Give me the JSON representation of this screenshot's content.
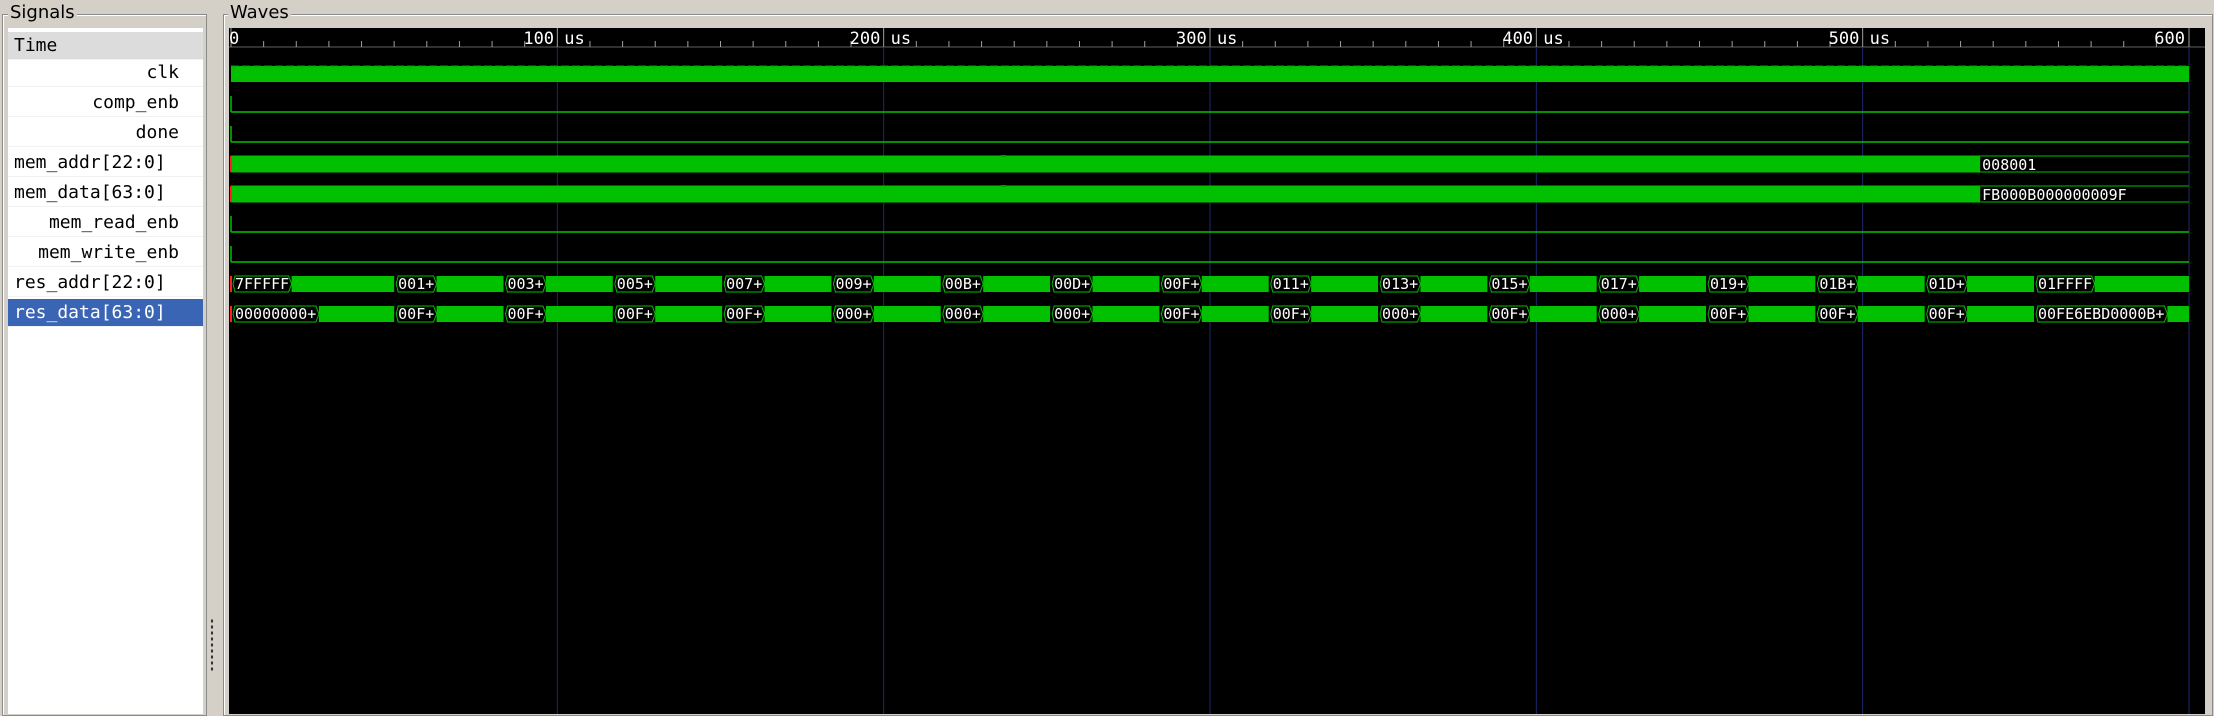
{
  "signals_group_title": "Signals",
  "waves_group_title": "Waves",
  "time_header": "Time",
  "ruler": {
    "max_us": 600,
    "ticks": [
      {
        "value": 0,
        "label": "0"
      },
      {
        "value": 100,
        "label": "100 us"
      },
      {
        "value": 200,
        "label": "200 us"
      },
      {
        "value": 300,
        "label": "300 us"
      },
      {
        "value": 400,
        "label": "400 us"
      },
      {
        "value": 500,
        "label": "500 us"
      },
      {
        "value": 600,
        "label": "600"
      }
    ]
  },
  "colors": {
    "wave": "#00c000",
    "wave_dark": "#008000",
    "grid": "#1c2a6e",
    "background": "#000000",
    "ruler_text": "#ffffff",
    "bus_text": "#ffffff",
    "marker_red": "#ff2020"
  },
  "signals": [
    {
      "name": "clk",
      "align": "right",
      "kind": "clock"
    },
    {
      "name": "comp_enb",
      "align": "right",
      "kind": "bit_low"
    },
    {
      "name": "done",
      "align": "right",
      "kind": "bit_low"
    },
    {
      "name": "mem_addr[22:0]",
      "align": "left",
      "kind": "bus_dense",
      "segments": [
        {
          "start": 0,
          "end": 536,
          "label": ""
        },
        {
          "start": 536,
          "end": 600,
          "label": "008001"
        }
      ]
    },
    {
      "name": "mem_data[63:0]",
      "align": "left",
      "kind": "bus_dense",
      "segments": [
        {
          "start": 0,
          "end": 536,
          "label": ""
        },
        {
          "start": 536,
          "end": 600,
          "label": "FB000B000000009F"
        }
      ]
    },
    {
      "name": "mem_read_enb",
      "align": "right",
      "kind": "bit_low"
    },
    {
      "name": "mem_write_enb",
      "align": "right",
      "kind": "bit_low"
    },
    {
      "name": "res_addr[22:0]",
      "align": "left",
      "kind": "bus",
      "segments": [
        {
          "start": 0,
          "end": 50,
          "label": "7FFFFF"
        },
        {
          "start": 50,
          "end": 83.5,
          "label": "001+"
        },
        {
          "start": 83.5,
          "end": 117,
          "label": "003+"
        },
        {
          "start": 117,
          "end": 150.5,
          "label": "005+"
        },
        {
          "start": 150.5,
          "end": 184,
          "label": "007+"
        },
        {
          "start": 184,
          "end": 217.5,
          "label": "009+"
        },
        {
          "start": 217.5,
          "end": 251,
          "label": "00B+"
        },
        {
          "start": 251,
          "end": 284.5,
          "label": "00D+"
        },
        {
          "start": 284.5,
          "end": 318,
          "label": "00F+"
        },
        {
          "start": 318,
          "end": 351.5,
          "label": "011+"
        },
        {
          "start": 351.5,
          "end": 385,
          "label": "013+"
        },
        {
          "start": 385,
          "end": 418.5,
          "label": "015+"
        },
        {
          "start": 418.5,
          "end": 452,
          "label": "017+"
        },
        {
          "start": 452,
          "end": 485.5,
          "label": "019+"
        },
        {
          "start": 485.5,
          "end": 519,
          "label": "01B+"
        },
        {
          "start": 519,
          "end": 552.5,
          "label": "01D+"
        },
        {
          "start": 552.5,
          "end": 600,
          "label": "01FFFF"
        }
      ]
    },
    {
      "name": "res_data[63:0]",
      "align": "left",
      "kind": "bus",
      "selected": true,
      "segments": [
        {
          "start": 0,
          "end": 50,
          "label": "00000000+"
        },
        {
          "start": 50,
          "end": 83.5,
          "label": "00F+"
        },
        {
          "start": 83.5,
          "end": 117,
          "label": "00F+"
        },
        {
          "start": 117,
          "end": 150.5,
          "label": "00F+"
        },
        {
          "start": 150.5,
          "end": 184,
          "label": "00F+"
        },
        {
          "start": 184,
          "end": 217.5,
          "label": "000+"
        },
        {
          "start": 217.5,
          "end": 251,
          "label": "000+"
        },
        {
          "start": 251,
          "end": 284.5,
          "label": "000+"
        },
        {
          "start": 284.5,
          "end": 318,
          "label": "00F+"
        },
        {
          "start": 318,
          "end": 351.5,
          "label": "00F+"
        },
        {
          "start": 351.5,
          "end": 385,
          "label": "000+"
        },
        {
          "start": 385,
          "end": 418.5,
          "label": "00F+"
        },
        {
          "start": 418.5,
          "end": 452,
          "label": "000+"
        },
        {
          "start": 452,
          "end": 485.5,
          "label": "00F+"
        },
        {
          "start": 485.5,
          "end": 519,
          "label": "00F+"
        },
        {
          "start": 519,
          "end": 552.5,
          "label": "00F+"
        },
        {
          "start": 552.5,
          "end": 600,
          "label": "00FE6EBD0000B+"
        }
      ]
    }
  ]
}
